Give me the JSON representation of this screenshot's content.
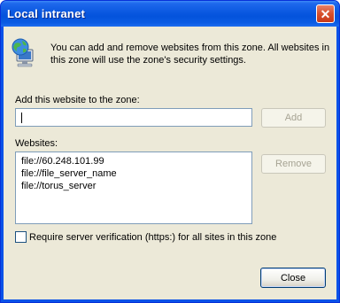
{
  "window": {
    "title": "Local intranet",
    "close_glyph": "✕"
  },
  "info": {
    "icon": "globe-computer-icon",
    "text": "You can add and remove websites from this zone. All websites in this zone will use the zone's security settings."
  },
  "add_section": {
    "label": "Add this website to the zone:",
    "input_value": "",
    "button_label": "Add"
  },
  "websites_section": {
    "label": "Websites:",
    "items": [
      "file://60.248.101.99",
      "file://file_server_name",
      "file://torus_server"
    ],
    "remove_button_label": "Remove"
  },
  "verification": {
    "label": "Require server verification (https:) for all sites in this zone",
    "checked": false
  },
  "footer": {
    "close_button_label": "Close"
  },
  "colors": {
    "titlebar": "#0a58e0",
    "client_bg": "#ece9d8",
    "close_red": "#d8502b"
  }
}
